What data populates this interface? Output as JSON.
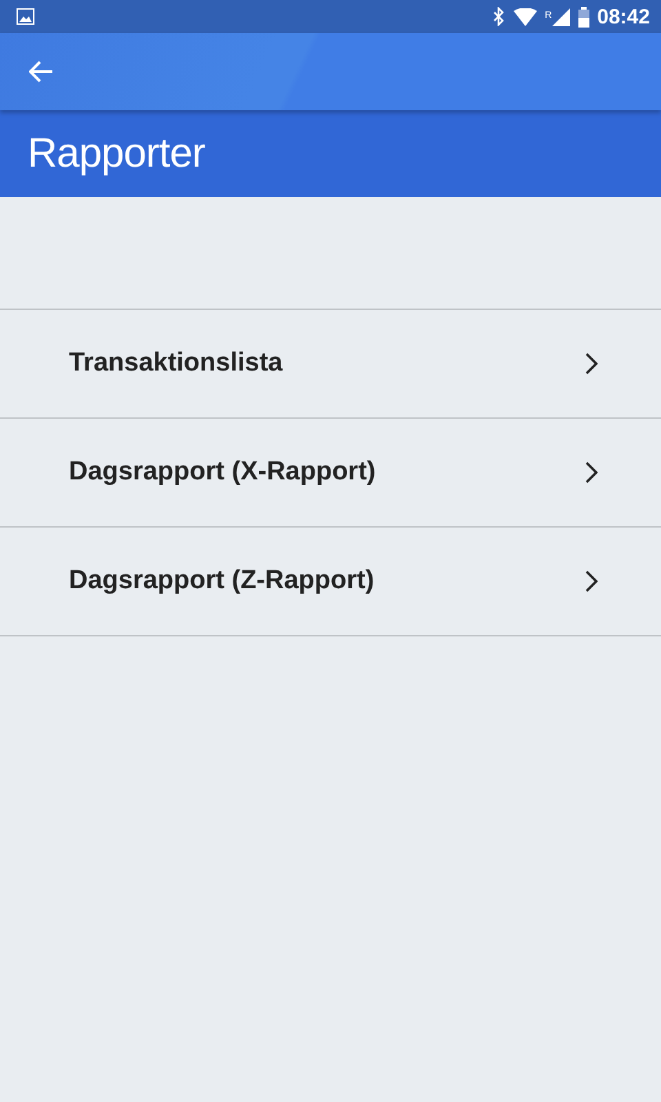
{
  "status_bar": {
    "roaming": "R",
    "time": "08:42"
  },
  "title": "Rapporter",
  "items": [
    {
      "label": "Transaktionslista"
    },
    {
      "label": "Dagsrapport (X-Rapport)"
    },
    {
      "label": "Dagsrapport (Z-Rapport)"
    }
  ]
}
